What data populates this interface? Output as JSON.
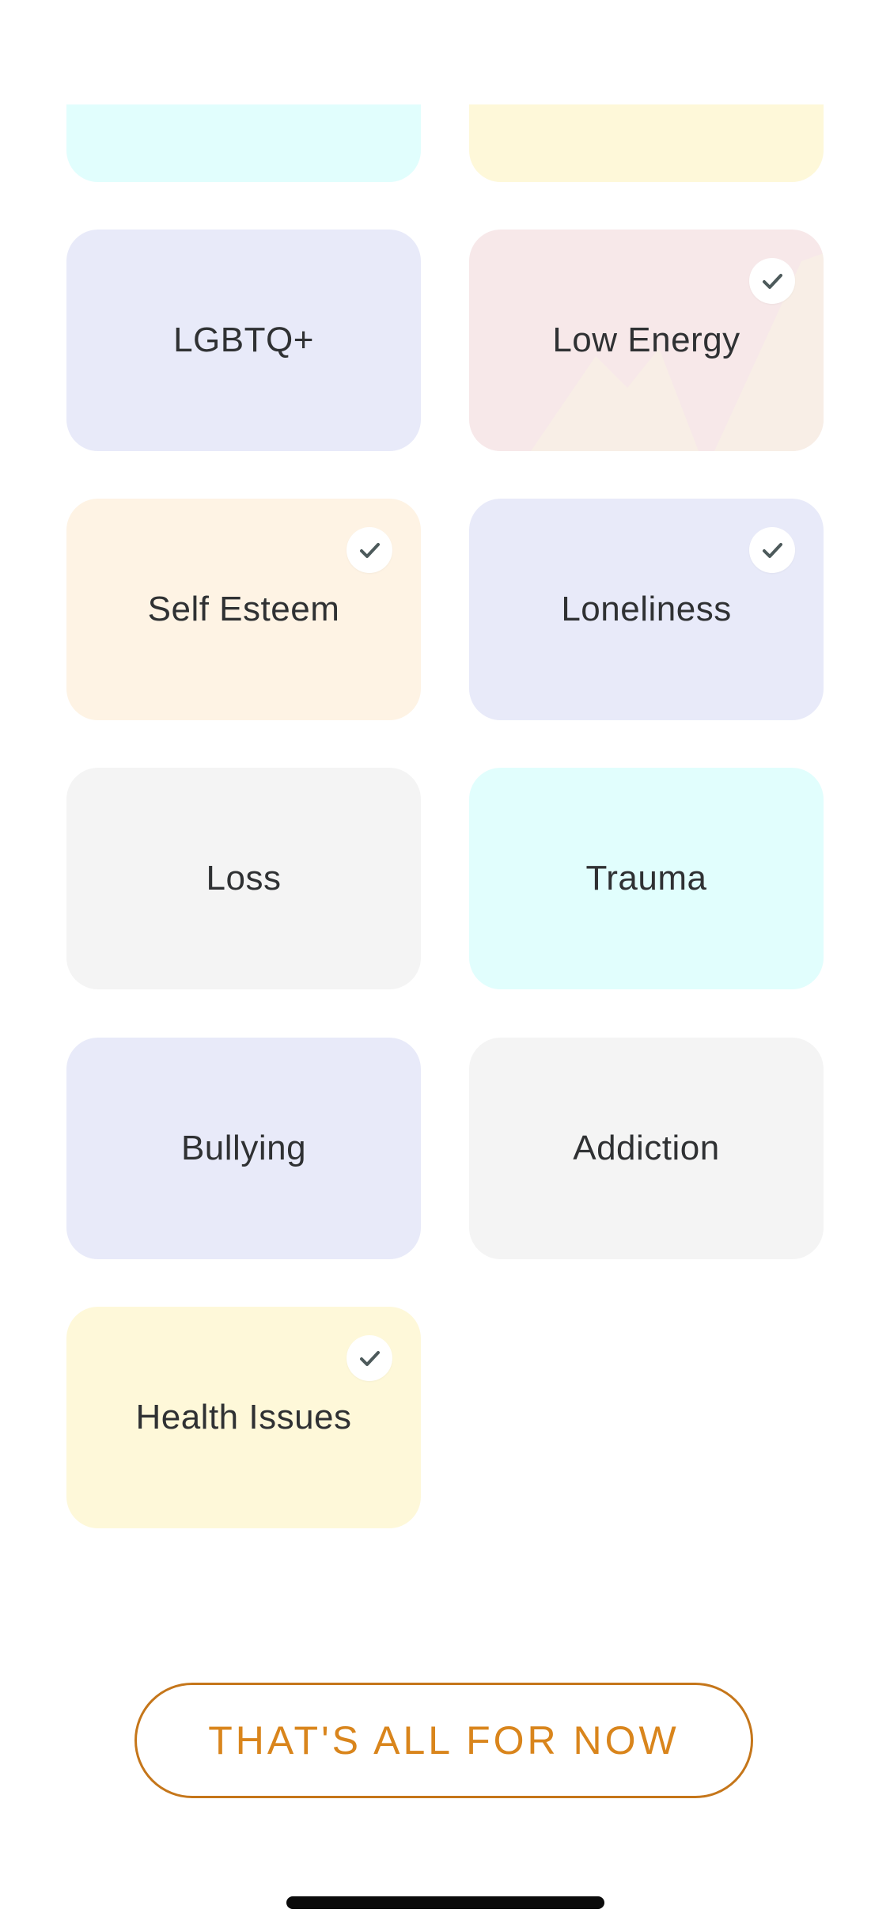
{
  "colors": {
    "cyan": "#e1fefd",
    "yellow": "#fef8d9",
    "lavender": "#e8eaf9",
    "pink": "#f7e8e9",
    "peach": "#fef3e4",
    "gray": "#f4f4f4",
    "check": "#4d5a5b",
    "cta": "#d9851c",
    "text": "#2f3133"
  },
  "topics": [
    {
      "label": "",
      "color": "cyan",
      "selected": false
    },
    {
      "label": "",
      "color": "yellow",
      "selected": false
    },
    {
      "label": "LGBTQ+",
      "color": "lavender",
      "selected": false
    },
    {
      "label": "Low Energy",
      "color": "pink",
      "selected": true
    },
    {
      "label": "Self Esteem",
      "color": "peach",
      "selected": true
    },
    {
      "label": "Loneliness",
      "color": "lavender",
      "selected": true
    },
    {
      "label": "Loss",
      "color": "gray",
      "selected": false
    },
    {
      "label": "Trauma",
      "color": "cyan",
      "selected": false
    },
    {
      "label": "Bullying",
      "color": "lavender",
      "selected": false
    },
    {
      "label": "Addiction",
      "color": "gray",
      "selected": false
    },
    {
      "label": "Health Issues",
      "color": "yellow",
      "selected": true
    }
  ],
  "cta_label": "THAT'S ALL FOR NOW",
  "icons": {
    "check": "check-icon",
    "decoration": "mountains-icon"
  }
}
